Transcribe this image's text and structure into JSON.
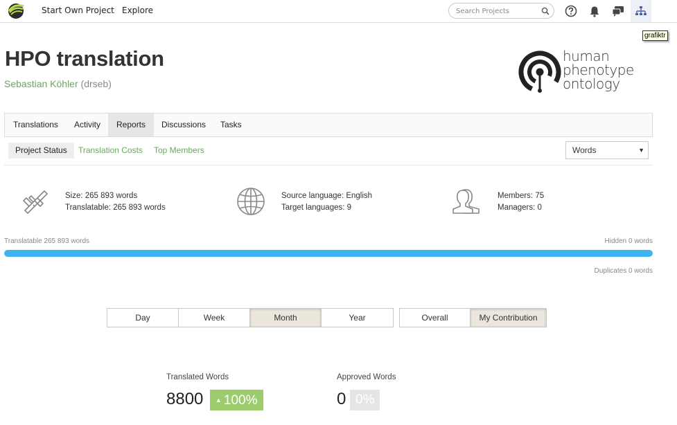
{
  "nav": {
    "links": [
      "Start Own Project",
      "Explore"
    ],
    "search_placeholder": "Search Projects",
    "tooltip": "grafiktr",
    "icons": [
      "search-icon",
      "help-icon",
      "bell-icon",
      "chat-icon",
      "sitemap-icon"
    ]
  },
  "project": {
    "title": "HPO translation",
    "owner_name": "Sebastian Köhler",
    "owner_handle": "(drseb)",
    "logo_lines": [
      "human",
      "phenotype",
      "ontology"
    ]
  },
  "tabs": [
    "Translations",
    "Activity",
    "Reports",
    "Discussions",
    "Tasks"
  ],
  "active_tab": "Reports",
  "subtabs": [
    "Project Status",
    "Translation Costs",
    "Top Members"
  ],
  "unit_select": "Words",
  "stats": {
    "size": "Size: 265 893 words",
    "translatable": "Translatable: 265 893 words",
    "source": "Source language: English",
    "target": "Target languages: 9",
    "members": "Members: 75",
    "managers": "Managers: 0"
  },
  "progress": {
    "left_label": "Translatable 265 893 words",
    "right_label": "Hidden 0 words",
    "duplicates_label": "Duplicates 0 words",
    "fraction": 1.0
  },
  "periods": [
    "Day",
    "Week",
    "Month",
    "Year"
  ],
  "active_period": "Month",
  "scope": [
    "Overall",
    "My Contribution"
  ],
  "active_scope": "My Contribution",
  "counters": {
    "translated_label": "Translated Words",
    "translated_value": "8800",
    "translated_badge": "100%",
    "approved_label": "Approved Words",
    "approved_value": "0",
    "approved_badge": "0%"
  },
  "colors": {
    "accent_green": "#6aa85a",
    "progress_blue": "#3db3ef",
    "badge_green": "#9ccc6c"
  }
}
